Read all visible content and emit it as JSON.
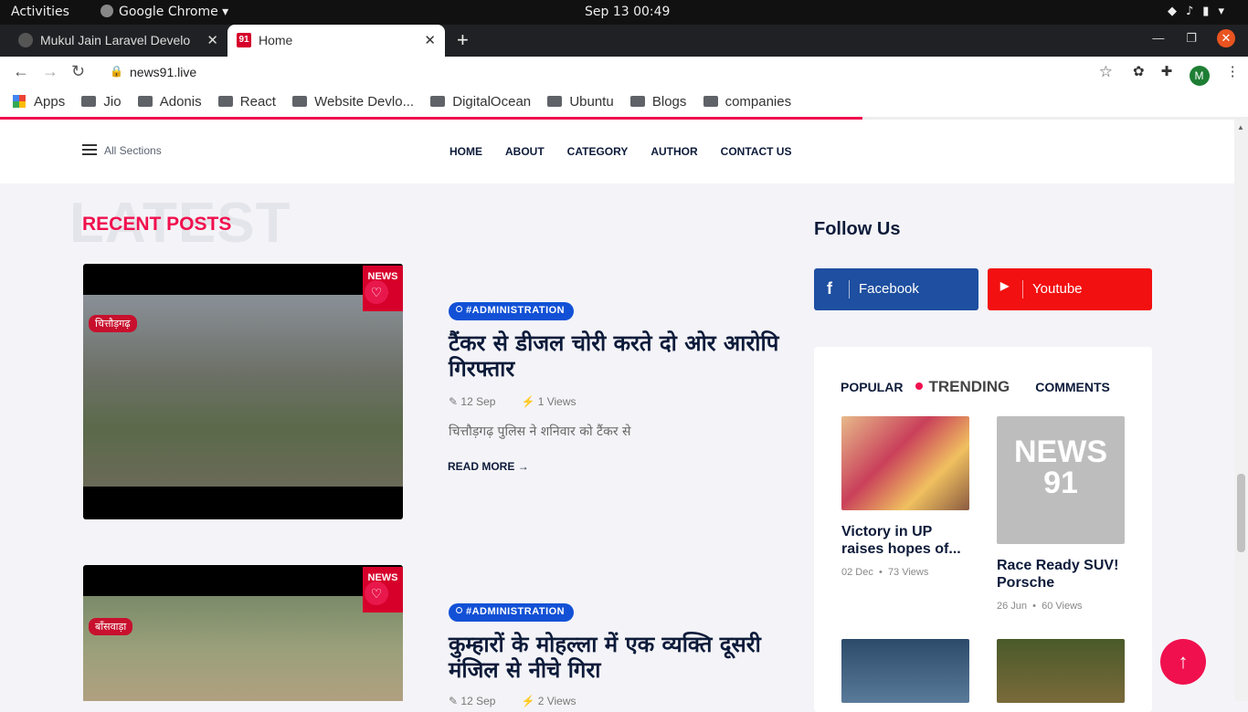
{
  "system_bar": {
    "activities": "Activities",
    "app_name": "Google Chrome",
    "clock": "Sep 13  00:49"
  },
  "tabs": [
    {
      "title": "Mukul Jain Laravel Develo",
      "active": false
    },
    {
      "title": "Home",
      "active": true
    }
  ],
  "browser": {
    "url": "news91.live"
  },
  "bookmarks": [
    "Apps",
    "Jio",
    "Adonis",
    "React",
    "Website Devlo...",
    "DigitalOcean",
    "Ubuntu",
    "Blogs",
    "companies"
  ],
  "site_header": {
    "all_sections": "All Sections",
    "nav": [
      "HOME",
      "ABOUT",
      "CATEGORY",
      "AUTHOR",
      "CONTACT US"
    ]
  },
  "main": {
    "watermark": "LATEST",
    "section_title": "RECENT POSTS",
    "posts": [
      {
        "location_tag": "चित्तौड़गढ़",
        "category": "#ADMINISTRATION",
        "title": "टैंकर से डीजल चोरी करते दो ओर आरोपि गिरफ्तार",
        "date": "12 Sep",
        "views": "1 Views",
        "excerpt": "चित्तौड़गढ़ पुलिस ने शनिवार को टैंकर से",
        "read_more": "READ MORE"
      },
      {
        "location_tag": "बाँसवाड़ा",
        "category": "#ADMINISTRATION",
        "title": "कुम्हारों के मोहल्ला में एक व्यक्ति दूसरी मंजिल से नीचे गिरा",
        "date": "12 Sep",
        "views": "2 Views"
      }
    ]
  },
  "sidebar": {
    "follow_title": "Follow Us",
    "social": [
      {
        "label": "Facebook",
        "color": "#1e4fa0"
      },
      {
        "label": "Youtube",
        "color": "#f21010"
      }
    ],
    "widget_tabs": [
      "POPULAR",
      "TRENDING",
      "COMMENTS"
    ],
    "active_widget_tab": "TRENDING",
    "cards": [
      {
        "title": "Victory in UP raises hopes of...",
        "date": "02 Dec",
        "views": "73 Views"
      },
      {
        "title": "Race Ready SUV! Porsche Cayenne...",
        "date": "26 Jun",
        "views": "60 Views"
      }
    ]
  },
  "colors": {
    "accent": "#f0104e",
    "navy": "#0d1b3a",
    "badge": "#1251d6"
  }
}
